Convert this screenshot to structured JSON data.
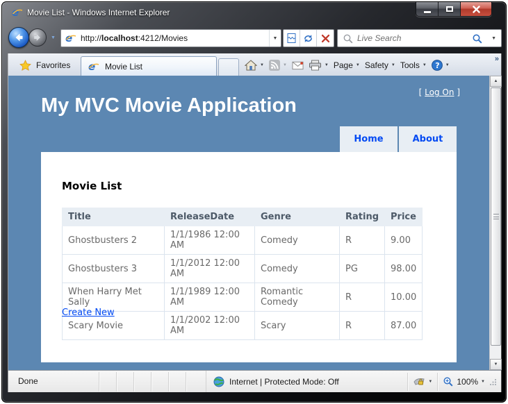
{
  "colors": {
    "page_background": "#5c87b2",
    "link_blue": "#034af3",
    "panel_background": "#e8eef4",
    "body_text": "#696969",
    "close_button_red": "#b03a2b"
  },
  "icons": {
    "caret_down": "▼",
    "chevron_more": "»",
    "scroll_up": "▲",
    "scroll_down": "▼",
    "help_mark": "?"
  },
  "titlebar": {
    "title": "Movie List - Windows Internet Explorer"
  },
  "navbar": {
    "url": {
      "protocol": "http://",
      "host": "localhost",
      "path": ":4212/Movies"
    },
    "search_placeholder": "Live Search"
  },
  "commandbar": {
    "favorites_label": "Favorites",
    "active_tab_title": "Movie List",
    "menu_page": "Page",
    "menu_safety": "Safety",
    "menu_tools": "Tools"
  },
  "page": {
    "logon_prefix": "[",
    "logon_label": "Log On",
    "logon_suffix": "]",
    "app_title": "My MVC Movie Application",
    "menu": [
      {
        "label": "Home"
      },
      {
        "label": "About"
      }
    ],
    "heading": "Movie List",
    "table": {
      "headers": [
        "Title",
        "ReleaseDate",
        "Genre",
        "Rating",
        "Price"
      ],
      "rows": [
        [
          "Ghostbusters 2",
          "1/1/1986 12:00 AM",
          "Comedy",
          "R",
          "9.00"
        ],
        [
          "Ghostbusters 3",
          "1/1/2012 12:00 AM",
          "Comedy",
          "PG",
          "98.00"
        ],
        [
          "When Harry Met Sally",
          "1/1/1989 12:00 AM",
          "Romantic Comedy",
          "R",
          "10.00"
        ],
        [
          "Scary Movie",
          "1/1/2002 12:00 AM",
          "Scary",
          "R",
          "87.00"
        ]
      ]
    },
    "create_link": "Create New"
  },
  "statusbar": {
    "status": "Done",
    "zone": "Internet | Protected Mode: Off",
    "zoom": "100%"
  }
}
